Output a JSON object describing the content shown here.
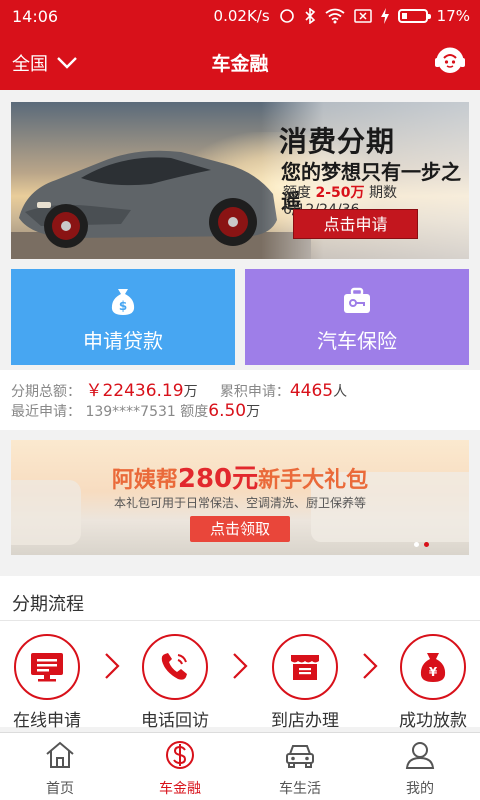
{
  "status": {
    "time": "14:06",
    "speed": "0.02K/s",
    "battery": "17%"
  },
  "nav": {
    "region": "全国",
    "title": "车金融"
  },
  "banner": {
    "title": "消费分期",
    "subtitle": "您的梦想只有一步之遥",
    "quota_label": "额度",
    "quota_value": "2-50万",
    "period": "期数6/12/24/36",
    "button": "点击申请"
  },
  "cards": {
    "loan": "申请贷款",
    "insurance": "汽车保险"
  },
  "stats": {
    "total_label": "分期总额：",
    "total_value": "￥22436.19",
    "total_unit": "万",
    "apply_label": "累积申请：",
    "apply_value": "4465",
    "apply_unit": "人",
    "recent_label": "最近申请：",
    "recent_phone": "139****7531",
    "recent_quota_label": "额度",
    "recent_quota_value": "6.50",
    "recent_quota_unit": "万"
  },
  "promo": {
    "title_pre": "阿姨帮",
    "title_amount": "280元",
    "title_post": "新手大礼包",
    "desc": "本礼包可用于日常保洁、空调清洗、厨卫保养等",
    "button": "点击领取"
  },
  "process": {
    "heading": "分期流程",
    "steps": [
      "在线申请",
      "电话回访",
      "到店办理",
      "成功放款"
    ]
  },
  "tabs": [
    "首页",
    "车金融",
    "车生活",
    "我的"
  ],
  "colors": {
    "brand": "#d8111a",
    "loan": "#47a6f2",
    "insurance": "#9e7ee8"
  }
}
